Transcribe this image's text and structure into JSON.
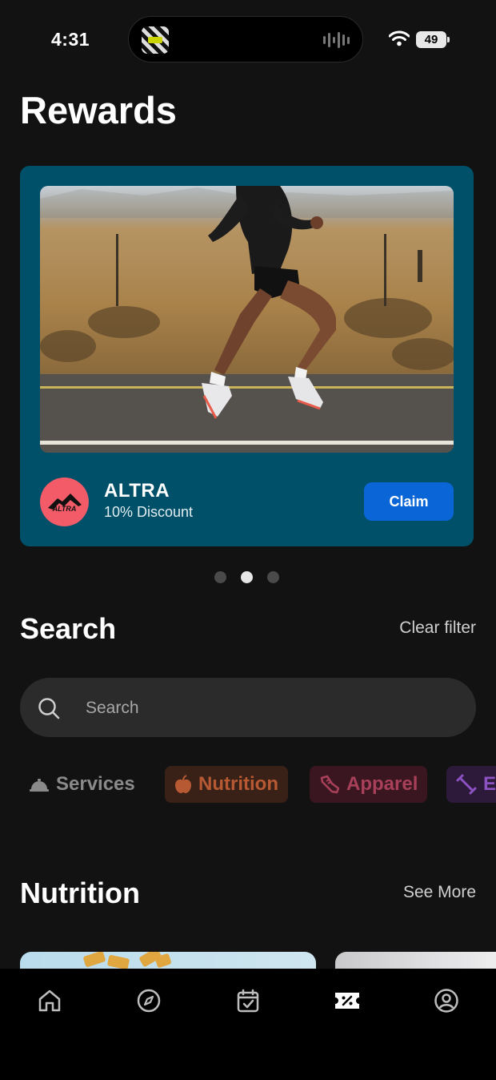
{
  "status_bar": {
    "time": "4:31",
    "battery": "49"
  },
  "page": {
    "title": "Rewards"
  },
  "reward_card": {
    "brand_name": "ALTRA",
    "brand_logo_text": "ALTRA",
    "offer": "10% Discount",
    "claim_label": "Claim",
    "background_color": "#005069",
    "logo_color": "#f45b68"
  },
  "carousel": {
    "page_count": 3,
    "active_index": 1
  },
  "search_section": {
    "title": "Search",
    "clear_label": "Clear filter",
    "placeholder": "Search"
  },
  "categories": [
    {
      "label": "Services",
      "icon": "service-bell-icon"
    },
    {
      "label": "Nutrition",
      "icon": "apple-icon"
    },
    {
      "label": "Apparel",
      "icon": "shoe-icon"
    },
    {
      "label": "Equipment",
      "icon": "dumbbell-icon"
    }
  ],
  "nutrition_section": {
    "title": "Nutrition",
    "see_more_label": "See More"
  },
  "tab_bar": {
    "items": [
      {
        "icon": "home-icon"
      },
      {
        "icon": "compass-icon"
      },
      {
        "icon": "calendar-check-icon"
      },
      {
        "icon": "ticket-icon",
        "active": true
      },
      {
        "icon": "profile-icon"
      }
    ]
  },
  "colors": {
    "accent": "#0a66d6",
    "background": "#121212"
  }
}
